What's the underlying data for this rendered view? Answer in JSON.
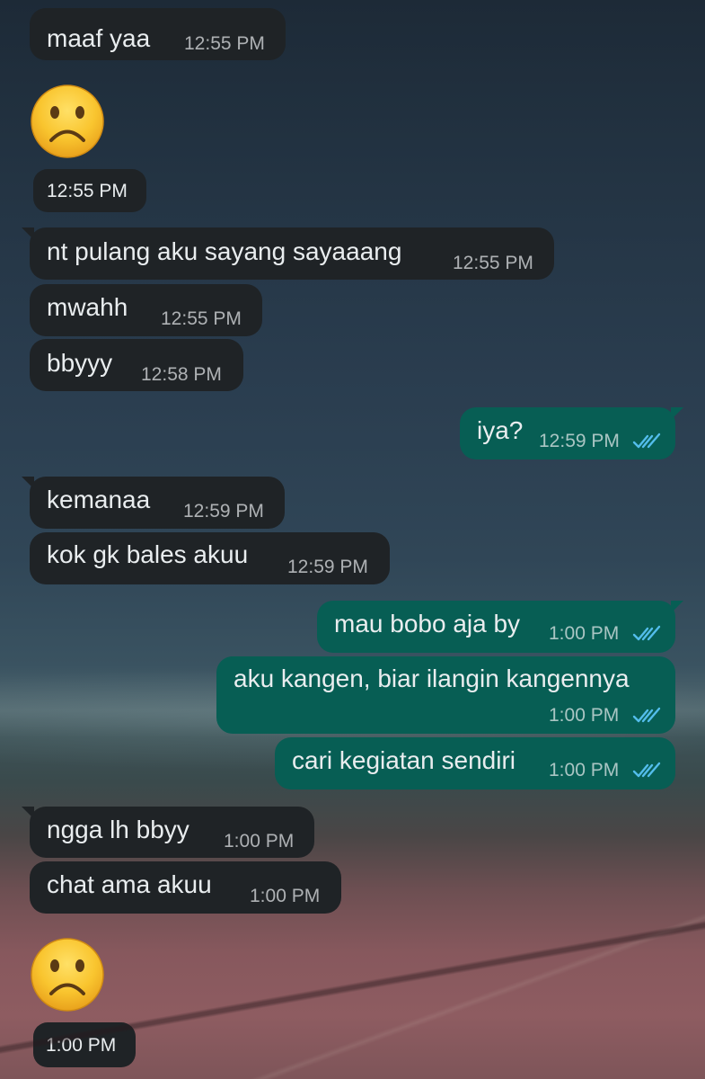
{
  "colors": {
    "incoming_bubble": "#1f2326",
    "outgoing_bubble": "#075e54",
    "read_receipt": "#53bdeb",
    "emoji_face": "#f7b32a"
  },
  "messages": [
    {
      "text": "maaf yaa",
      "time": "12:55 PM",
      "direction": "incoming"
    },
    {
      "emoji": "frowning-face",
      "time": "12:55 PM",
      "direction": "incoming"
    },
    {
      "text": "nt pulang aku sayang sayaaang",
      "time": "12:55 PM",
      "direction": "incoming"
    },
    {
      "text": "mwahh",
      "time": "12:55 PM",
      "direction": "incoming"
    },
    {
      "text": "bbyyy",
      "time": "12:58 PM",
      "direction": "incoming"
    },
    {
      "text": "iya?",
      "time": "12:59 PM",
      "direction": "outgoing",
      "status": "read"
    },
    {
      "text": "kemanaa",
      "time": "12:59 PM",
      "direction": "incoming"
    },
    {
      "text": "kok gk bales akuu",
      "time": "12:59 PM",
      "direction": "incoming"
    },
    {
      "text": "mau bobo aja by",
      "time": "1:00 PM",
      "direction": "outgoing",
      "status": "read"
    },
    {
      "text": "aku kangen, biar ilangin kangennya",
      "time": "1:00 PM",
      "direction": "outgoing",
      "status": "read"
    },
    {
      "text": "cari kegiatan sendiri",
      "time": "1:00 PM",
      "direction": "outgoing",
      "status": "read"
    },
    {
      "text": "ngga lh bbyy",
      "time": "1:00 PM",
      "direction": "incoming"
    },
    {
      "text": "chat ama akuu",
      "time": "1:00 PM",
      "direction": "incoming"
    },
    {
      "emoji": "frowning-face",
      "time": "1:00 PM",
      "direction": "incoming"
    }
  ]
}
